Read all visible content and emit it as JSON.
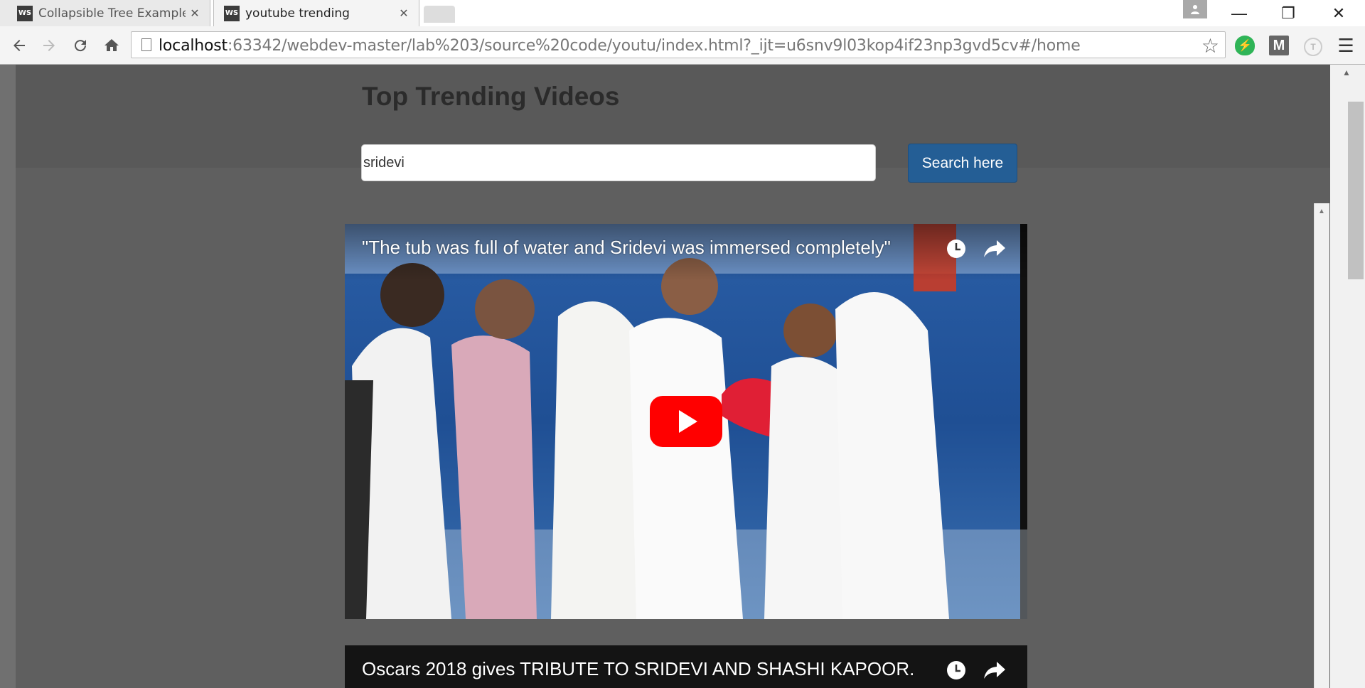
{
  "browser": {
    "tabs": [
      {
        "icon": "WS",
        "title": "Collapsible Tree Example",
        "close": "✕"
      },
      {
        "icon": "WS",
        "title": "youtube trending",
        "close": "✕"
      }
    ],
    "url_host": "localhost",
    "url_rest": ":63342/webdev-master/lab%203/source%20code/youtu/index.html?_ijt=u6snv9l03kop4if23np3gvd5cv#/home",
    "window_controls": {
      "minimize": "—",
      "restore": "❐",
      "close": "✕"
    }
  },
  "page": {
    "title": "Top Trending Videos",
    "search": {
      "value": "sridevi",
      "button": "Search here"
    }
  },
  "videos": [
    {
      "title": "\"The tub was full of water and Sridevi was immersed completely\""
    },
    {
      "title": "Oscars 2018 gives TRIBUTE TO SRIDEVI AND SHASHI KAPOOR."
    }
  ],
  "colors": {
    "page_bg": "#5f5f5f",
    "search_button": "#245e95",
    "play_button": "#ff0000"
  }
}
